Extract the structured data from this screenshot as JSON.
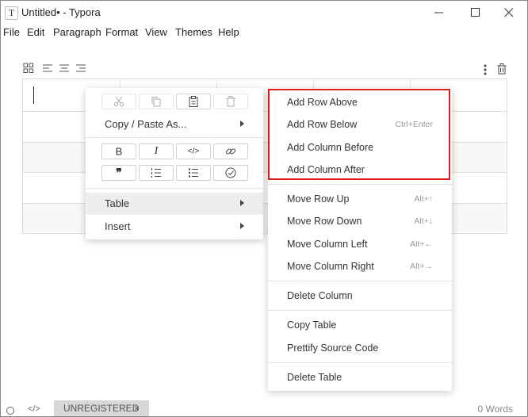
{
  "window": {
    "app_icon_glyph": "T",
    "title": "Untitled• - Typora"
  },
  "menubar": [
    "File",
    "Edit",
    "Paragraph",
    "Format",
    "View",
    "Themes",
    "Help"
  ],
  "table_toolbar": {
    "left_icons": [
      "grid-icon",
      "align-left-icon",
      "align-center-icon",
      "align-right-icon"
    ],
    "right_icons": [
      "more-vertical-icon",
      "trash-icon"
    ]
  },
  "context_menu": {
    "icon_row_1": [
      "cut-icon",
      "copy-icon",
      "paste-icon",
      "delete-icon"
    ],
    "copy_paste": "Copy / Paste As...",
    "format_row_1": [
      {
        "icon": "bold-icon",
        "text": "B"
      },
      {
        "icon": "italic-icon",
        "text": "I"
      },
      {
        "icon": "code-icon",
        "text": "</>"
      },
      {
        "icon": "link-icon",
        "text": ""
      }
    ],
    "format_row_2": [
      {
        "icon": "quote-icon",
        "text": "❞"
      },
      {
        "icon": "ordered-list-icon",
        "text": ""
      },
      {
        "icon": "unordered-list-icon",
        "text": ""
      },
      {
        "icon": "task-list-icon",
        "text": ""
      }
    ],
    "table": "Table",
    "insert": "Insert"
  },
  "table_submenu": {
    "group1": [
      {
        "label": "Add Row Above",
        "shortcut": ""
      },
      {
        "label": "Add Row Below",
        "shortcut": "Ctrl+Enter"
      },
      {
        "label": "Add Column Before",
        "shortcut": ""
      },
      {
        "label": "Add Column After",
        "shortcut": ""
      }
    ],
    "group2": [
      {
        "label": "Move Row Up",
        "shortcut": "Alt+↑"
      },
      {
        "label": "Move Row Down",
        "shortcut": "Alt+↓"
      },
      {
        "label": "Move Column Left",
        "shortcut": "Alt+←"
      },
      {
        "label": "Move Column Right",
        "shortcut": "Alt+→"
      }
    ],
    "group3": [
      {
        "label": "Delete Column"
      }
    ],
    "group4": [
      {
        "label": "Copy Table"
      },
      {
        "label": "Prettify Source Code"
      }
    ],
    "group5": [
      {
        "label": "Delete Table"
      }
    ]
  },
  "highlight_color": "#e01b1b",
  "statusbar": {
    "tab_label": "UNREGISTERED",
    "tab_close": "×",
    "code_glyph": "</>",
    "word_count": "0 Words"
  }
}
